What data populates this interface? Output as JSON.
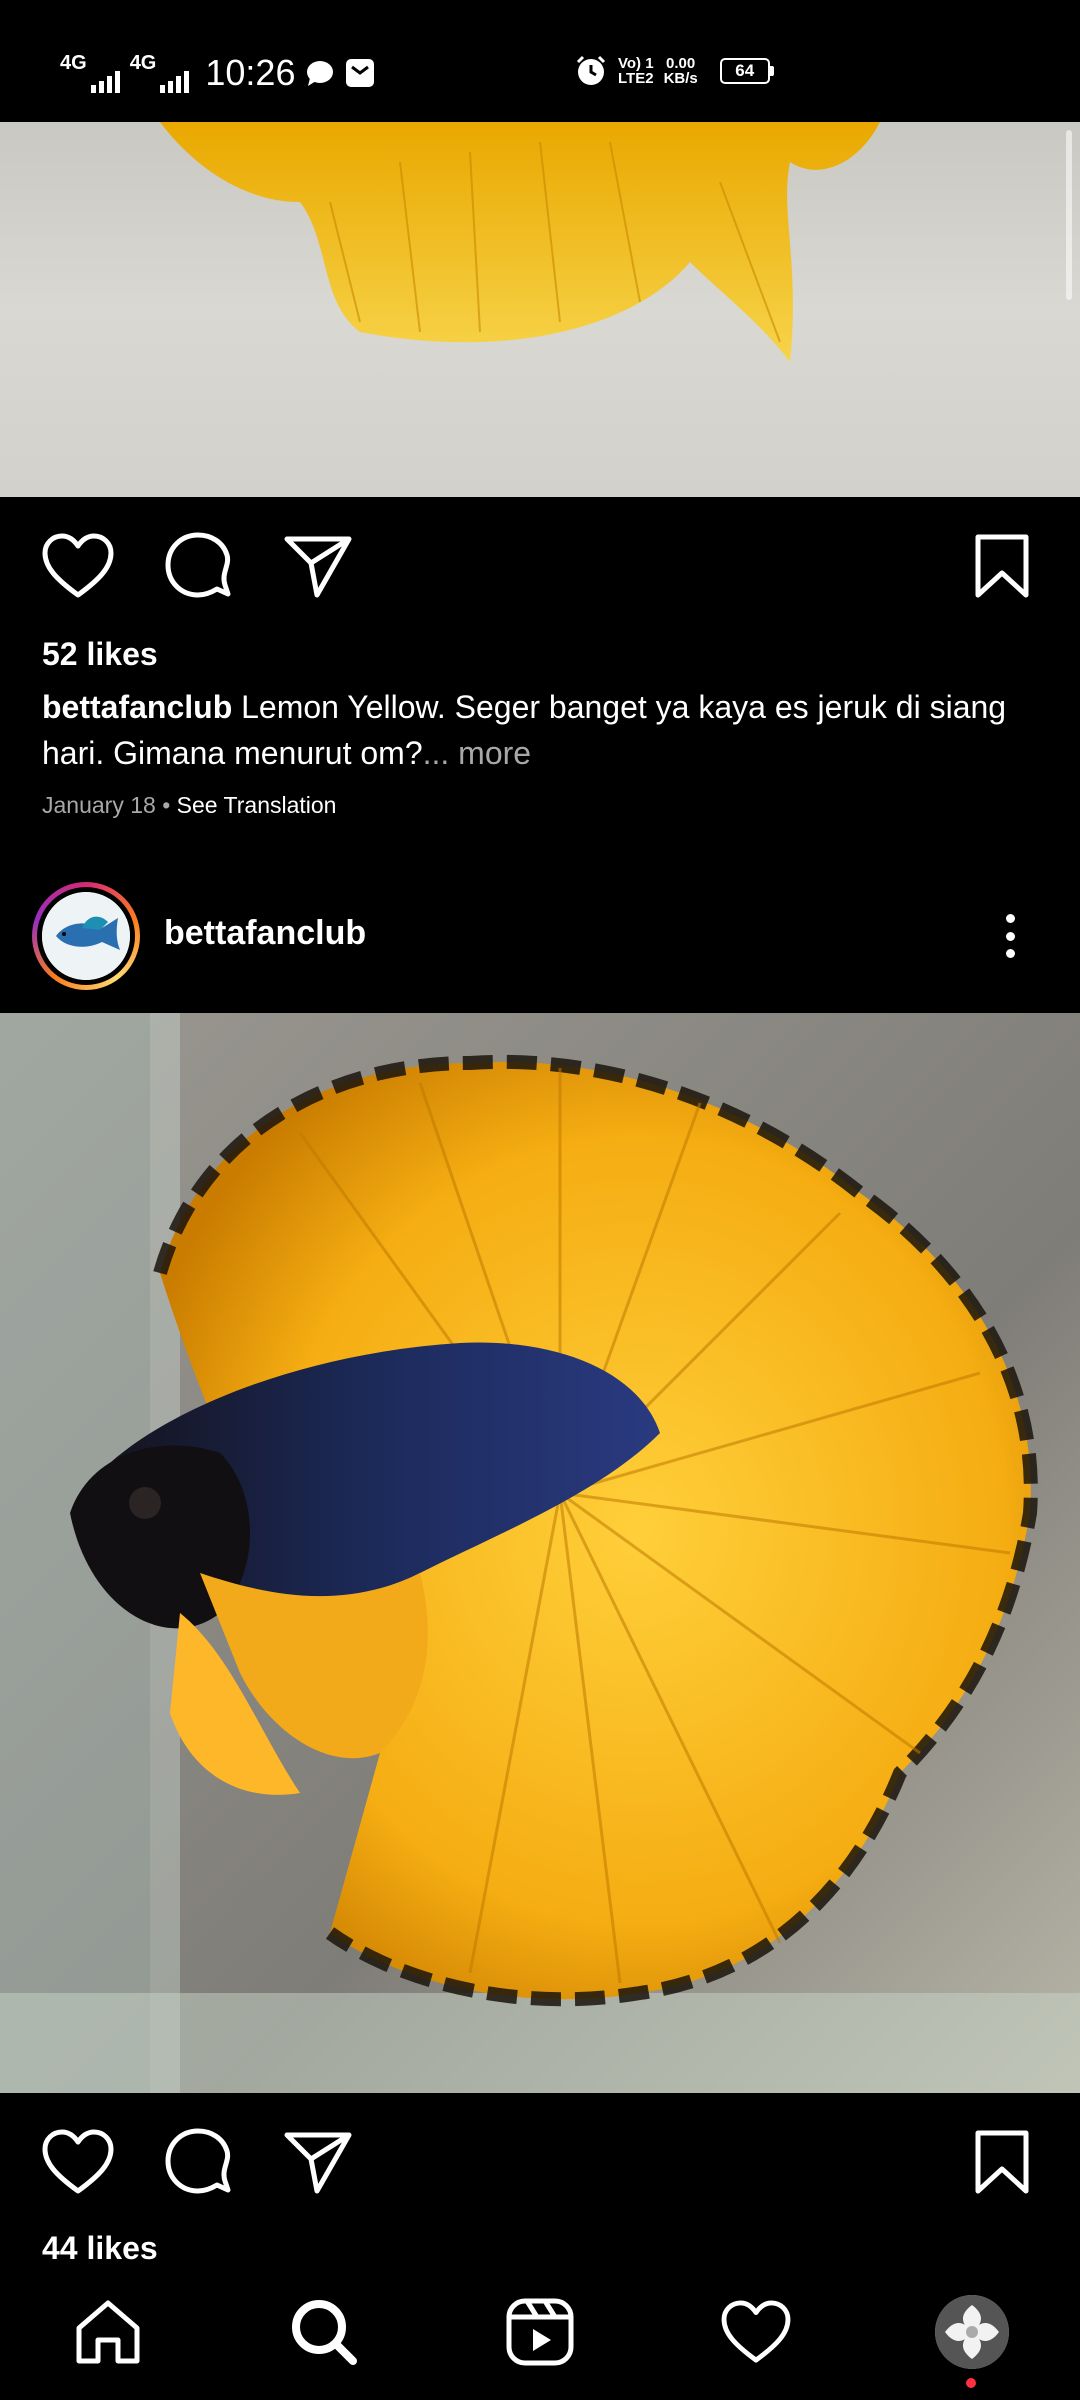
{
  "status_bar": {
    "net1": "4G",
    "net2": "4G",
    "time": "10:26",
    "volte_top": "Vo) 1",
    "volte_bottom": "LTE2",
    "speed_top": "0.00",
    "speed_bottom": "KB/s",
    "battery": "64",
    "icons": [
      "signal-icon",
      "message-bubble-icon",
      "mail-icon",
      "alarm-icon",
      "battery-icon"
    ]
  },
  "post1": {
    "likes": "52 likes",
    "username": "bettafanclub",
    "caption": " Lemon Yellow. Seger banget ya kaya es jeruk di siang hari. Gimana menurut om?",
    "more": "... more",
    "date": "January 18",
    "separator": " • ",
    "see_translation": "See Translation",
    "image": "betta-fish-lemon-yellow-fins"
  },
  "post2": {
    "username": "bettafanclub",
    "image": "betta-fish-blue-body-yellow-halfmoon-fins",
    "likes": "44 likes"
  },
  "actions": [
    "heart-icon",
    "comment-icon",
    "share-icon",
    "bookmark-icon"
  ],
  "nav": [
    "home-icon",
    "search-icon",
    "reels-icon",
    "heart-icon",
    "profile-avatar"
  ],
  "colors": {
    "background": "#000000",
    "secondary_text": "#a8a8a8",
    "story_ring": "#d62976",
    "notification_dot": "#ff3040"
  }
}
